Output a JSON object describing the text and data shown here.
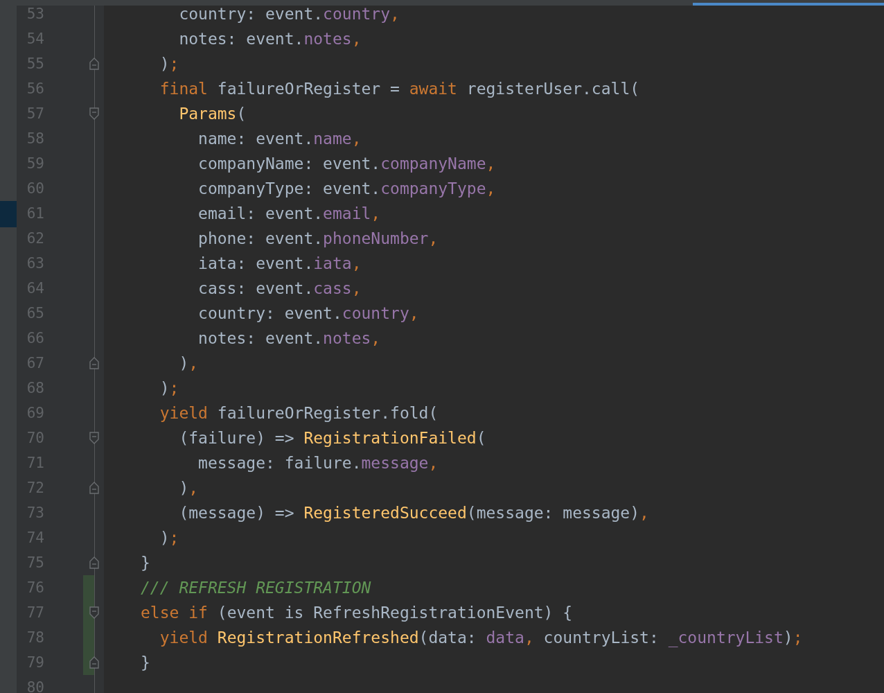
{
  "editor": {
    "lines": [
      {
        "number": "53",
        "kind": "plain",
        "changed": false,
        "marked": false,
        "tokens": [
          {
            "kind": "plain",
            "text": "    country: event."
          },
          {
            "kind": "field",
            "text": "country"
          },
          {
            "kind": "keyword",
            "text": ","
          }
        ]
      },
      {
        "number": "54",
        "kind": "plain",
        "changed": false,
        "marked": false,
        "tokens": [
          {
            "kind": "plain",
            "text": "    notes: event."
          },
          {
            "kind": "field",
            "text": "notes"
          },
          {
            "kind": "keyword",
            "text": ","
          }
        ]
      },
      {
        "number": "55",
        "kind": "fold-end",
        "changed": false,
        "marked": false,
        "tokens": [
          {
            "kind": "plain",
            "text": "  )"
          },
          {
            "kind": "keyword",
            "text": ";"
          }
        ]
      },
      {
        "number": "56",
        "kind": "plain",
        "changed": false,
        "marked": false,
        "tokens": [
          {
            "kind": "keyword",
            "text": "  final"
          },
          {
            "kind": "plain",
            "text": " failureOrRegister = "
          },
          {
            "kind": "keyword",
            "text": "await"
          },
          {
            "kind": "plain",
            "text": " registerUser.call("
          }
        ]
      },
      {
        "number": "57",
        "kind": "fold-start",
        "changed": false,
        "marked": false,
        "tokens": [
          {
            "kind": "class",
            "text": "    Params"
          },
          {
            "kind": "plain",
            "text": "("
          }
        ]
      },
      {
        "number": "58",
        "kind": "plain",
        "changed": false,
        "marked": false,
        "tokens": [
          {
            "kind": "plain",
            "text": "      name: event."
          },
          {
            "kind": "field",
            "text": "name"
          },
          {
            "kind": "keyword",
            "text": ","
          }
        ]
      },
      {
        "number": "59",
        "kind": "plain",
        "changed": false,
        "marked": false,
        "tokens": [
          {
            "kind": "plain",
            "text": "      companyName: event."
          },
          {
            "kind": "field",
            "text": "companyName"
          },
          {
            "kind": "keyword",
            "text": ","
          }
        ]
      },
      {
        "number": "60",
        "kind": "plain",
        "changed": false,
        "marked": false,
        "tokens": [
          {
            "kind": "plain",
            "text": "      companyType: event."
          },
          {
            "kind": "field",
            "text": "companyType"
          },
          {
            "kind": "keyword",
            "text": ","
          }
        ]
      },
      {
        "number": "61",
        "kind": "plain",
        "changed": false,
        "marked": true,
        "tokens": [
          {
            "kind": "plain",
            "text": "      email: event."
          },
          {
            "kind": "field",
            "text": "email"
          },
          {
            "kind": "keyword",
            "text": ","
          }
        ]
      },
      {
        "number": "62",
        "kind": "plain",
        "changed": false,
        "marked": false,
        "tokens": [
          {
            "kind": "plain",
            "text": "      phone: event."
          },
          {
            "kind": "field",
            "text": "phoneNumber"
          },
          {
            "kind": "keyword",
            "text": ","
          }
        ]
      },
      {
        "number": "63",
        "kind": "plain",
        "changed": false,
        "marked": false,
        "tokens": [
          {
            "kind": "plain",
            "text": "      iata: event."
          },
          {
            "kind": "field",
            "text": "iata"
          },
          {
            "kind": "keyword",
            "text": ","
          }
        ]
      },
      {
        "number": "64",
        "kind": "plain",
        "changed": false,
        "marked": false,
        "tokens": [
          {
            "kind": "plain",
            "text": "      cass: event."
          },
          {
            "kind": "field",
            "text": "cass"
          },
          {
            "kind": "keyword",
            "text": ","
          }
        ]
      },
      {
        "number": "65",
        "kind": "plain",
        "changed": false,
        "marked": false,
        "tokens": [
          {
            "kind": "plain",
            "text": "      country: event."
          },
          {
            "kind": "field",
            "text": "country"
          },
          {
            "kind": "keyword",
            "text": ","
          }
        ]
      },
      {
        "number": "66",
        "kind": "plain",
        "changed": false,
        "marked": false,
        "tokens": [
          {
            "kind": "plain",
            "text": "      notes: event."
          },
          {
            "kind": "field",
            "text": "notes"
          },
          {
            "kind": "keyword",
            "text": ","
          }
        ]
      },
      {
        "number": "67",
        "kind": "fold-end",
        "changed": false,
        "marked": false,
        "tokens": [
          {
            "kind": "plain",
            "text": "    )"
          },
          {
            "kind": "keyword",
            "text": ","
          }
        ]
      },
      {
        "number": "68",
        "kind": "plain",
        "changed": false,
        "marked": false,
        "tokens": [
          {
            "kind": "plain",
            "text": "  )"
          },
          {
            "kind": "keyword",
            "text": ";"
          }
        ]
      },
      {
        "number": "69",
        "kind": "plain",
        "changed": false,
        "marked": false,
        "tokens": [
          {
            "kind": "keyword",
            "text": "  yield"
          },
          {
            "kind": "plain",
            "text": " failureOrRegister.fold("
          }
        ]
      },
      {
        "number": "70",
        "kind": "fold-start",
        "changed": false,
        "marked": false,
        "tokens": [
          {
            "kind": "plain",
            "text": "    (failure) => "
          },
          {
            "kind": "class",
            "text": "RegistrationFailed"
          },
          {
            "kind": "plain",
            "text": "("
          }
        ]
      },
      {
        "number": "71",
        "kind": "plain",
        "changed": false,
        "marked": false,
        "tokens": [
          {
            "kind": "plain",
            "text": "      message: failure."
          },
          {
            "kind": "field",
            "text": "message"
          },
          {
            "kind": "keyword",
            "text": ","
          }
        ]
      },
      {
        "number": "72",
        "kind": "fold-end",
        "changed": false,
        "marked": false,
        "tokens": [
          {
            "kind": "plain",
            "text": "    )"
          },
          {
            "kind": "keyword",
            "text": ","
          }
        ]
      },
      {
        "number": "73",
        "kind": "plain",
        "changed": false,
        "marked": false,
        "tokens": [
          {
            "kind": "plain",
            "text": "    (message) => "
          },
          {
            "kind": "class",
            "text": "RegisteredSucceed"
          },
          {
            "kind": "plain",
            "text": "(message: message)"
          },
          {
            "kind": "keyword",
            "text": ","
          }
        ]
      },
      {
        "number": "74",
        "kind": "plain",
        "changed": false,
        "marked": false,
        "tokens": [
          {
            "kind": "plain",
            "text": "  )"
          },
          {
            "kind": "keyword",
            "text": ";"
          }
        ]
      },
      {
        "number": "75",
        "kind": "fold-end",
        "changed": false,
        "marked": false,
        "tokens": [
          {
            "kind": "plain",
            "text": "}"
          }
        ]
      },
      {
        "number": "76",
        "kind": "plain",
        "changed": true,
        "marked": false,
        "tokens": [
          {
            "kind": "comment",
            "text": "/// REFRESH REGISTRATION"
          }
        ]
      },
      {
        "number": "77",
        "kind": "fold-start",
        "changed": true,
        "marked": false,
        "tokens": [
          {
            "kind": "keyword",
            "text": "else if"
          },
          {
            "kind": "plain",
            "text": " (event is RefreshRegistrationEvent) {"
          }
        ]
      },
      {
        "number": "78",
        "kind": "plain",
        "changed": true,
        "marked": false,
        "tokens": [
          {
            "kind": "keyword",
            "text": "  yield "
          },
          {
            "kind": "class",
            "text": "RegistrationRefreshed"
          },
          {
            "kind": "plain",
            "text": "(data: "
          },
          {
            "kind": "field",
            "text": "data"
          },
          {
            "kind": "keyword",
            "text": ","
          },
          {
            "kind": "plain",
            "text": " countryList: "
          },
          {
            "kind": "field",
            "text": "_countryList"
          },
          {
            "kind": "plain",
            "text": ")"
          },
          {
            "kind": "keyword",
            "text": ";"
          }
        ]
      },
      {
        "number": "79",
        "kind": "fold-end",
        "changed": true,
        "marked": false,
        "tokens": [
          {
            "kind": "plain",
            "text": "}"
          }
        ]
      },
      {
        "number": "80",
        "kind": "plain",
        "changed": false,
        "marked": false
      }
    ]
  }
}
